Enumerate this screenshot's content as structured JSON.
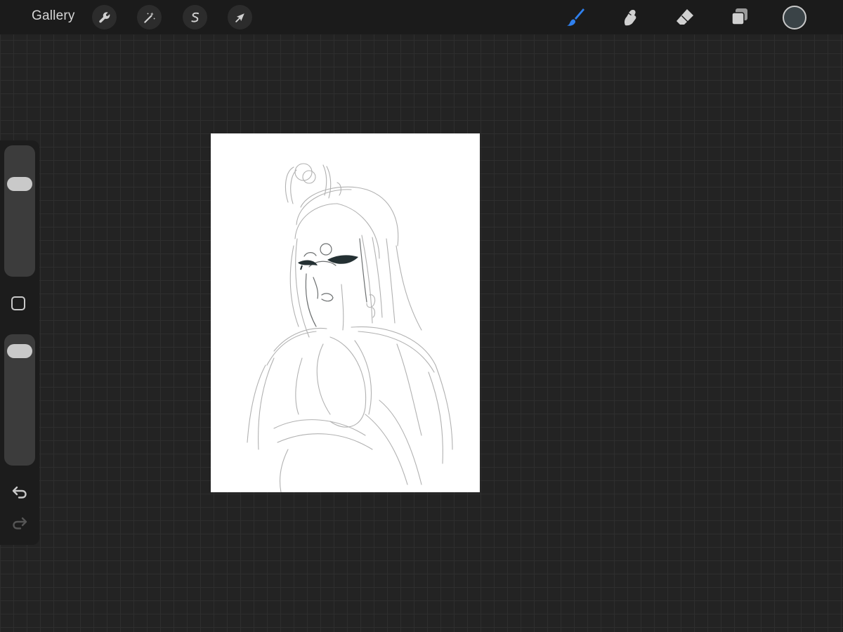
{
  "toolbar": {
    "gallery_label": "Gallery",
    "left_tools": [
      {
        "name": "actions",
        "icon": "wrench-icon"
      },
      {
        "name": "adjustments",
        "icon": "magic-wand-icon"
      },
      {
        "name": "selection",
        "icon": "selection-s-icon"
      },
      {
        "name": "transform",
        "icon": "arrow-cursor-icon"
      }
    ],
    "right_tools": [
      {
        "name": "paint",
        "icon": "brush-icon",
        "active": true
      },
      {
        "name": "smudge",
        "icon": "smudge-icon",
        "active": false
      },
      {
        "name": "erase",
        "icon": "eraser-icon",
        "active": false
      },
      {
        "name": "layers",
        "icon": "layers-icon",
        "active": false
      }
    ],
    "current_color": "#3a4347"
  },
  "sidebar": {
    "brush_size_level": 0.74,
    "opacity_level": 0.94
  },
  "colors": {
    "accent": "#2f80ee",
    "toolbar_bg": "#1b1b1b",
    "workspace_bg": "#232323",
    "grid_line": "#2e2e2e",
    "icon": "#d0d0d0"
  },
  "canvas": {
    "background": "#ffffff"
  }
}
